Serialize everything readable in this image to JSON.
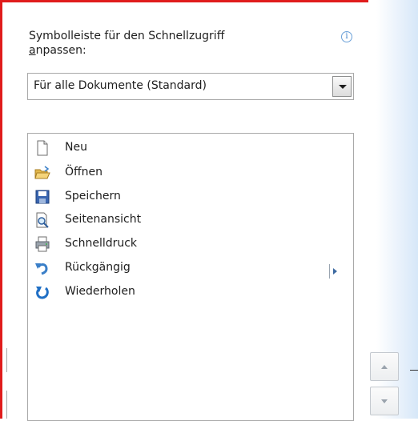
{
  "quick_access": {
    "label_line1": "Symbolleiste für den Schnellzugriff",
    "label_line2_accel": "a",
    "label_line2_rest": "npassen:",
    "info_icon": "info-icon"
  },
  "scope_dropdown": {
    "selected": "Für alle Dokumente (Standard)"
  },
  "commands": [
    {
      "label": "Neu",
      "icon": "new-document-icon"
    },
    {
      "label": "Öffnen",
      "icon": "open-folder-icon"
    },
    {
      "label": "Speichern",
      "icon": "save-disk-icon"
    },
    {
      "label": "Seitenansicht",
      "icon": "print-preview-icon"
    },
    {
      "label": "Schnelldruck",
      "icon": "quick-print-icon"
    },
    {
      "label": "Rückgängig",
      "icon": "undo-icon"
    },
    {
      "label": "Wiederholen",
      "icon": "redo-icon"
    }
  ],
  "colors": {
    "accent_red": "#e01c1c",
    "undo_blue": "#3a7fc8",
    "redo_blue": "#1f6fc5"
  }
}
